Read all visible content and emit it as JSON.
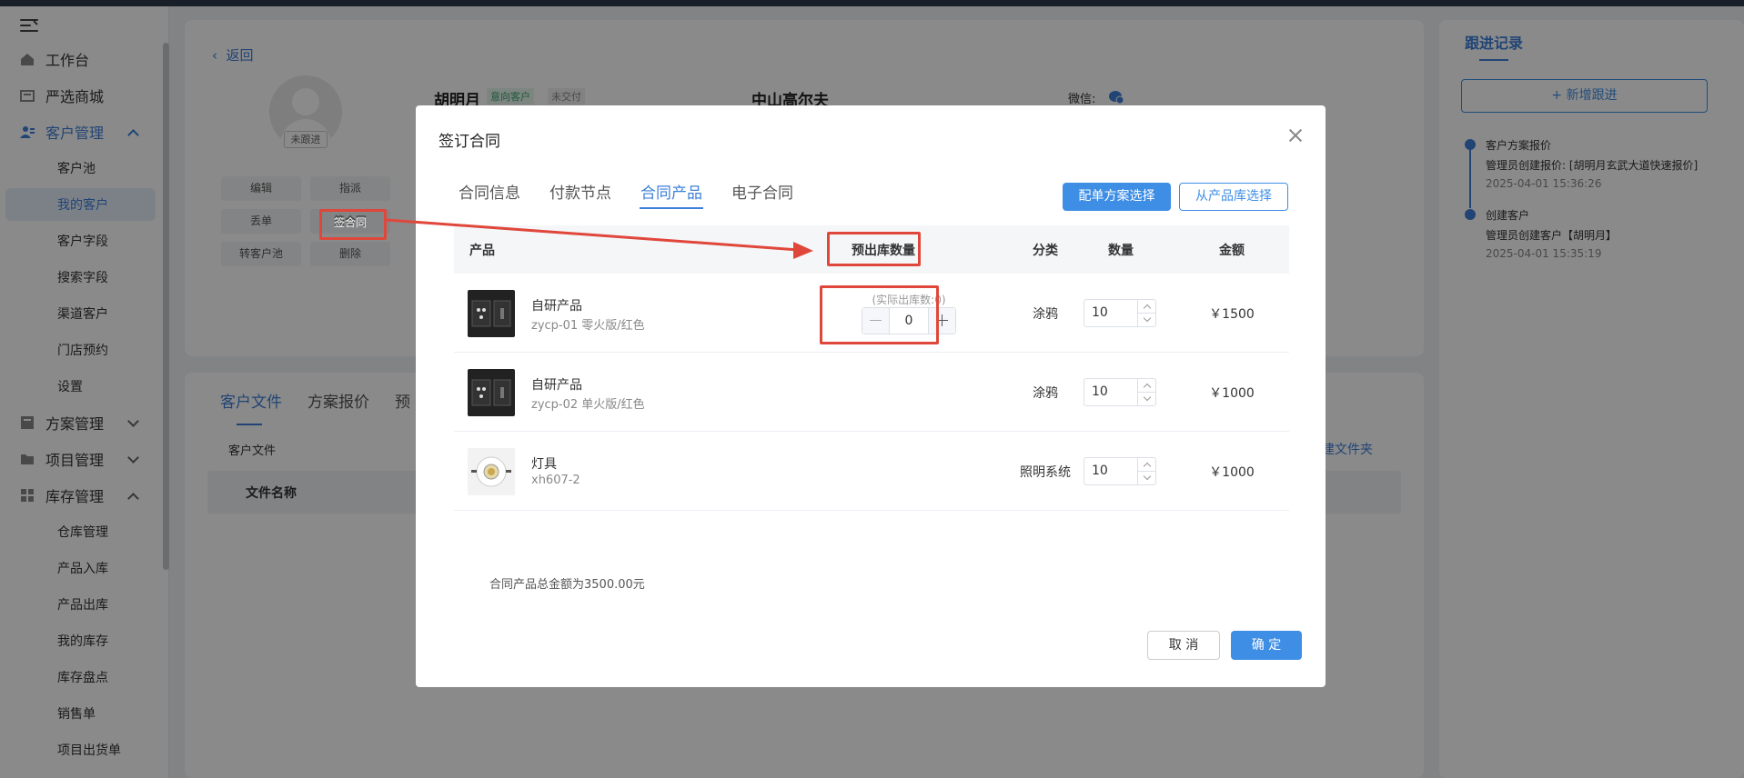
{
  "sidebar": {
    "items": [
      {
        "label": "工作台"
      },
      {
        "label": "严选商城"
      },
      {
        "label": "客户管理"
      },
      {
        "label": "方案管理"
      },
      {
        "label": "项目管理"
      },
      {
        "label": "库存管理"
      }
    ],
    "customer_sub": [
      "客户池",
      "我的客户",
      "客户字段",
      "搜索字段",
      "渠道客户",
      "门店预约",
      "设置"
    ],
    "inventory_sub": [
      "仓库管理",
      "产品入库",
      "产品出库",
      "我的库存",
      "库存盘点",
      "销售单",
      "项目出货单"
    ]
  },
  "customer": {
    "back_label": "返回",
    "name": "胡明月",
    "intent_badge": "意向客户",
    "pay_badge": "未交付",
    "company": "中山高尔夫",
    "wechat_label": "微信:",
    "follow_tag": "未跟进",
    "actions": [
      "编辑",
      "指派",
      "丢单",
      "签合同",
      "转客户池",
      "删除"
    ]
  },
  "bottom_tabs": [
    "客户文件",
    "方案报价",
    "预"
  ],
  "files": {
    "sub_label": "客户文件",
    "col_name": "文件名称",
    "new_folder": "建文件夹"
  },
  "followup": {
    "title": "跟进记录",
    "add_button": "+ 新增跟进",
    "entries": [
      {
        "title": "客户方案报价",
        "desc": "管理员创建报价: [胡明月玄武大道快速报价]",
        "time": "2025-04-01 15:36:26"
      },
      {
        "title": "创建客户",
        "desc": "管理员创建客户【胡明月】",
        "time": "2025-04-01 15:35:19"
      }
    ]
  },
  "modal": {
    "title": "签订合同",
    "tabs": [
      "合同信息",
      "付款节点",
      "合同产品",
      "电子合同"
    ],
    "btn_scheme": "配单方案选择",
    "btn_library": "从产品库选择",
    "columns": {
      "product": "产品",
      "pre_out": "预出库数量",
      "category": "分类",
      "quantity": "数量",
      "amount": "金额"
    },
    "actual_out_label": "(实际出库数:0)",
    "stepper_value": "0",
    "rows": [
      {
        "name": "自研产品",
        "sku": "zycp-01 零火版/红色",
        "category": "涂鸦",
        "quantity": "10",
        "amount": "￥1500"
      },
      {
        "name": "自研产品",
        "sku": "zycp-02 单火版/红色",
        "category": "涂鸦",
        "quantity": "10",
        "amount": "￥1000"
      },
      {
        "name": "灯具",
        "sku": "xh607-2",
        "category": "照明系统",
        "quantity": "10",
        "amount": "￥1000"
      }
    ],
    "total_text": "合同产品总金额为3500.00元",
    "cancel": "取 消",
    "confirm": "确 定"
  },
  "colors": {
    "accent": "#3e7fd8",
    "highlight": "#e0473b"
  }
}
